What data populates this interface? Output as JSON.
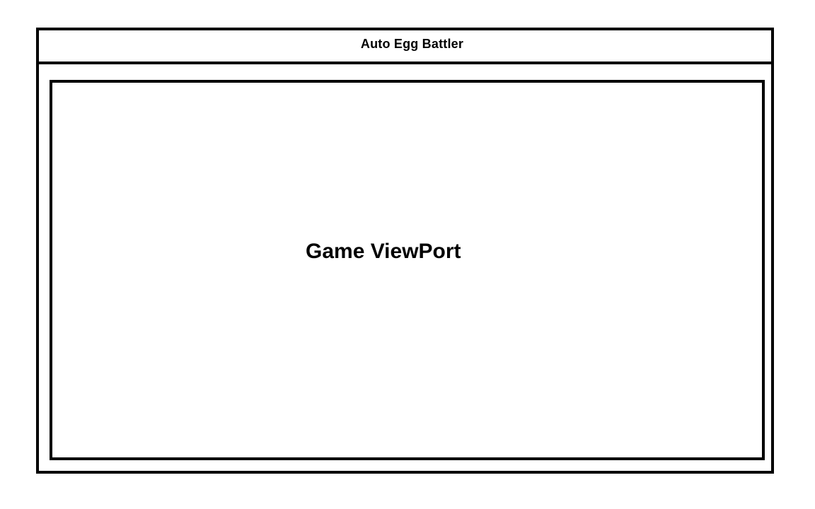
{
  "app": {
    "title": "Auto Egg Battler"
  },
  "viewport": {
    "label": "Game ViewPort"
  }
}
